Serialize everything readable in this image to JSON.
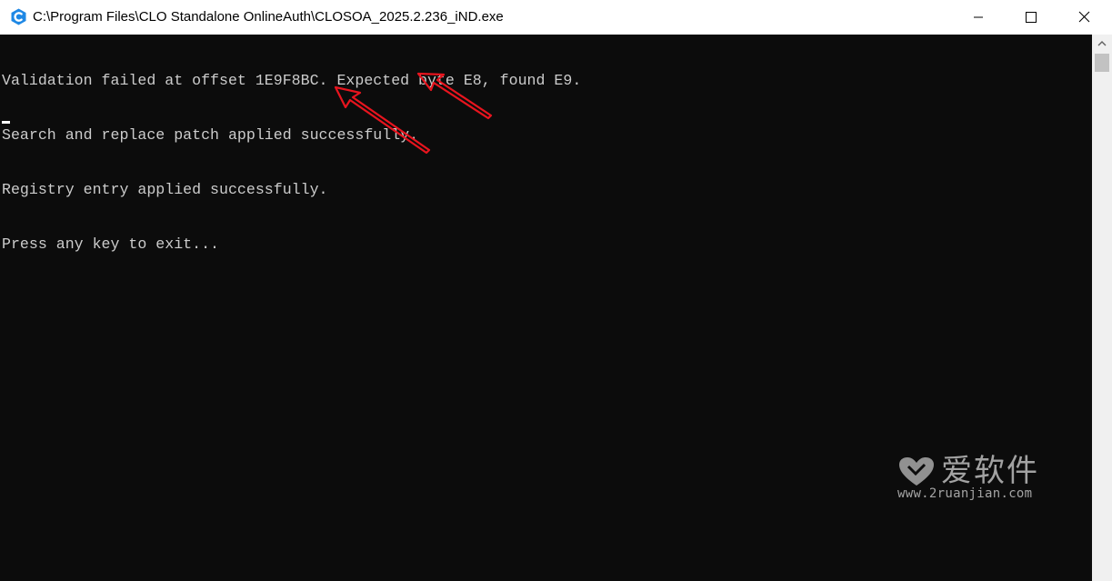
{
  "window": {
    "title": "C:\\Program Files\\CLO Standalone OnlineAuth\\CLOSOA_2025.2.236_iND.exe",
    "icons": {
      "app": "app-c-icon",
      "minimize": "minimize-icon",
      "maximize": "maximize-icon",
      "close": "close-icon"
    }
  },
  "console": {
    "lines": [
      "Validation failed at offset 1E9F8BC. Expected byte E8, found E9.",
      "Search and replace patch applied successfully.",
      "Registry entry applied successfully.",
      "Press any key to exit..."
    ],
    "text_color": "#cccccc",
    "background": "#0c0c0c"
  },
  "annotations": {
    "arrow_color": "#e8141e",
    "arrows": [
      "red-arrow-icon",
      "red-arrow-icon"
    ]
  },
  "watermark": {
    "title": "爱软件",
    "url": "www.2ruanjian.com"
  }
}
